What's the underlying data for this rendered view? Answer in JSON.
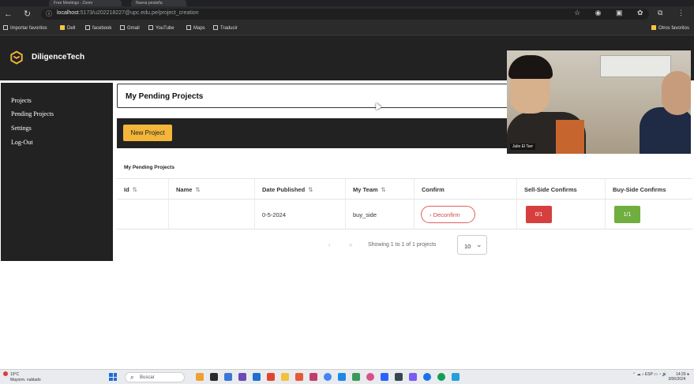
{
  "browser": {
    "tabs": [
      {
        "label": "Free Meetings - Zoom"
      },
      {
        "label": "Nueva pestaña"
      }
    ],
    "url_host": "localhost",
    "url_rest": ":5173/u202218227@upc.edu.pe/project_creation",
    "bookmarks": [
      {
        "label": "Importar favoritos"
      },
      {
        "label": "Dell"
      },
      {
        "label": "facebook"
      },
      {
        "label": "Gmail"
      },
      {
        "label": "YouTube"
      },
      {
        "label": "Maps"
      },
      {
        "label": "Traducir"
      }
    ],
    "other_favorites": "Otros favoritos"
  },
  "app": {
    "brand": "DiligenceTech",
    "sidebar": {
      "items": [
        {
          "label": "Projects"
        },
        {
          "label": "Pending Projects"
        },
        {
          "label": "Settings"
        },
        {
          "label": "Log-Out"
        }
      ]
    },
    "page_title": "My Pending Projects",
    "new_project_label": "New Project",
    "section_label": "My Pending Projects",
    "table": {
      "headers": [
        "Id",
        "Name",
        "Date Published",
        "My Team",
        "Confirm",
        "Sell-Side Confirms",
        "Buy-Side Confirms"
      ],
      "sort_glyph": "⇅",
      "rows": [
        {
          "id": "",
          "name": "",
          "date": "0-5-2024",
          "team": "buy_side",
          "confirm": "Deconfirm",
          "sell_confirms": "0/1",
          "buy_confirms": "1/1"
        }
      ]
    },
    "pagination": {
      "summary": "Showing 1 to 1 of 1 projects",
      "per_page": "10"
    },
    "colors": {
      "dark": "#222222",
      "accent": "#f3b63a",
      "danger": "#d73f3f",
      "success": "#6fae3f"
    }
  },
  "video": {
    "participant_name": "Julio El Tarr"
  },
  "taskbar": {
    "weather_temp": "19°C",
    "weather_desc": "Mayorm. nublado",
    "search_placeholder": "Buscar",
    "language": "ESP",
    "time": "14:29",
    "date": "3/06/2024"
  }
}
